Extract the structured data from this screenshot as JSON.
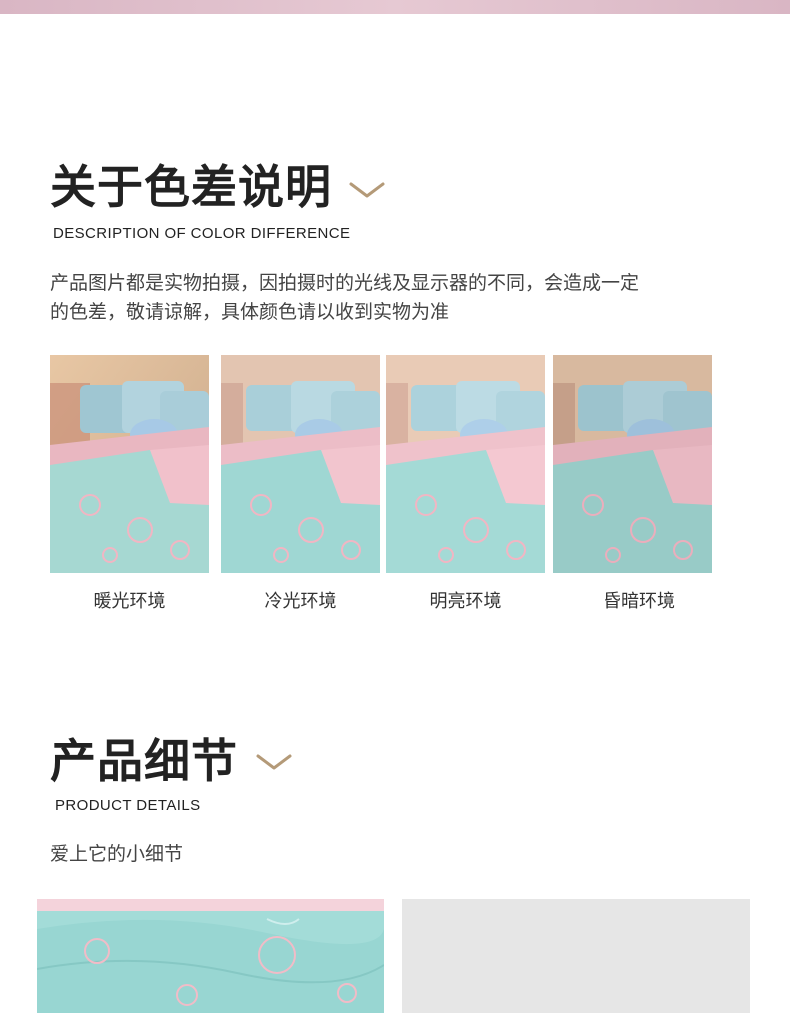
{
  "section_color": {
    "title": "关于色差说明",
    "subtitle": "DESCRIPTION OF COLOR DIFFERENCE",
    "description_lines": [
      "产品图片都是实物拍摄，因拍摄时的光线及显示器的不同，会造成一定",
      "的色差，敬请谅解，具体颜色请以收到实物为准"
    ],
    "icon": "chevron-down-icon",
    "environments": [
      {
        "label": "暖光环境"
      },
      {
        "label": "冷光环境"
      },
      {
        "label": "明亮环境"
      },
      {
        "label": "昏暗环境"
      }
    ]
  },
  "section_details": {
    "title": "产品细节",
    "subtitle": "PRODUCT DETAILS",
    "tagline": "爱上它的小细节",
    "icon": "chevron-down-icon"
  },
  "colors": {
    "accent": "#b49a78",
    "top_band": "#e1c1cd",
    "bedding_mint": "#9fd6d3",
    "bedding_pink": "#f0bcc6"
  }
}
